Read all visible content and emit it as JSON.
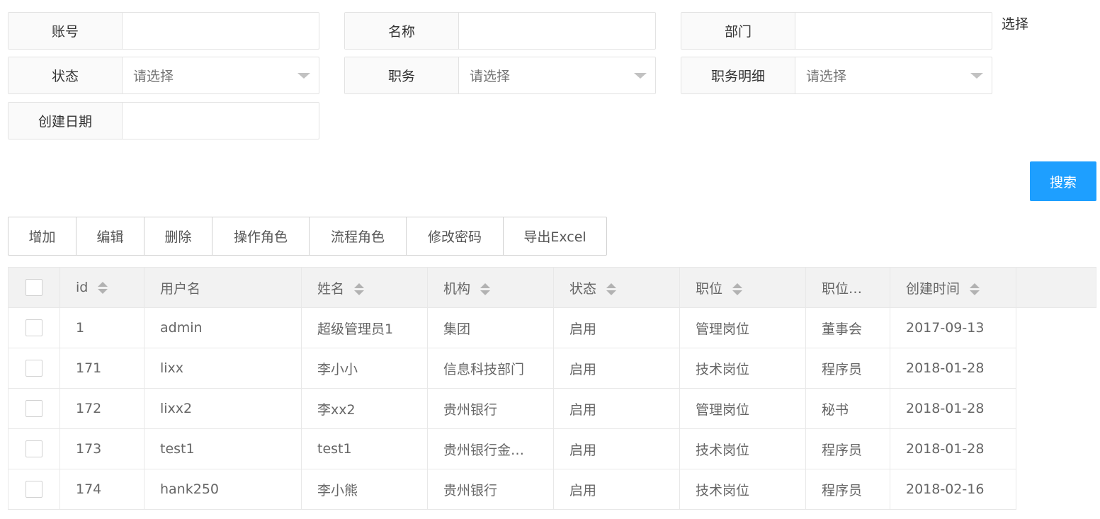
{
  "filters": {
    "account": {
      "label": "账号",
      "value": ""
    },
    "name": {
      "label": "名称",
      "value": ""
    },
    "department": {
      "label": "部门",
      "value": ""
    },
    "select_link": "选择",
    "status": {
      "label": "状态",
      "placeholder": "请选择"
    },
    "position": {
      "label": "职务",
      "placeholder": "请选择"
    },
    "position_detail": {
      "label": "职务明细",
      "placeholder": "请选择"
    },
    "created_date": {
      "label": "创建日期",
      "value": ""
    }
  },
  "search_label": "搜索",
  "toolbar": {
    "add": "增加",
    "edit": "编辑",
    "delete": "删除",
    "op_role": "操作角色",
    "flow_role": "流程角色",
    "change_password": "修改密码",
    "export_excel": "导出Excel"
  },
  "table": {
    "headers": {
      "id": "id",
      "username": "用户名",
      "fullname": "姓名",
      "org": "机构",
      "status": "状态",
      "post": "职位",
      "post_detail": "职位…",
      "created": "创建时间"
    },
    "rows": [
      {
        "id": "1",
        "username": "admin",
        "fullname": "超级管理员1",
        "org": "集团",
        "status": "启用",
        "post": "管理岗位",
        "post_detail": "董事会",
        "created": "2017-09-13"
      },
      {
        "id": "171",
        "username": "lixx",
        "fullname": "李小小",
        "org": "信息科技部门",
        "status": "启用",
        "post": "技术岗位",
        "post_detail": "程序员",
        "created": "2018-01-28"
      },
      {
        "id": "172",
        "username": "lixx2",
        "fullname": "李xx2",
        "org": "贵州银行",
        "status": "启用",
        "post": "管理岗位",
        "post_detail": "秘书",
        "created": "2018-01-28"
      },
      {
        "id": "173",
        "username": "test1",
        "fullname": "test1",
        "org": "贵州银行金…",
        "status": "启用",
        "post": "技术岗位",
        "post_detail": "程序员",
        "created": "2018-01-28"
      },
      {
        "id": "174",
        "username": "hank250",
        "fullname": "李小熊",
        "org": "贵州银行",
        "status": "启用",
        "post": "技术岗位",
        "post_detail": "程序员",
        "created": "2018-02-16"
      }
    ]
  },
  "colors": {
    "primary": "#1e9fff",
    "header_bg": "#f2f2f2",
    "border": "#e8e8e8"
  }
}
